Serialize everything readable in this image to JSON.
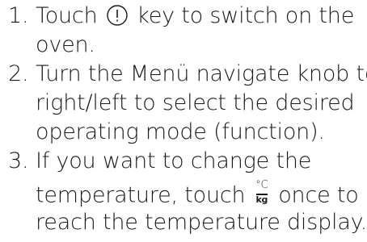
{
  "steps": [
    {
      "number": "1.",
      "line1_before": "Touch ",
      "icon": "power-icon",
      "line1_after": " key to switch on the",
      "line2": "oven."
    },
    {
      "number": "2.",
      "line1": "Turn the Menü navigate knob to",
      "line2": "right/left to select the desired",
      "line3": "operating mode (function)."
    },
    {
      "number": "3.",
      "line1": "If you want to change the",
      "line2_before": "temperature, touch ",
      "icon": "temperature-weight-icon",
      "icon_top": "°C",
      "icon_bottom": "kg",
      "line2_after": " once to",
      "line3": "reach the temperature display."
    }
  ]
}
